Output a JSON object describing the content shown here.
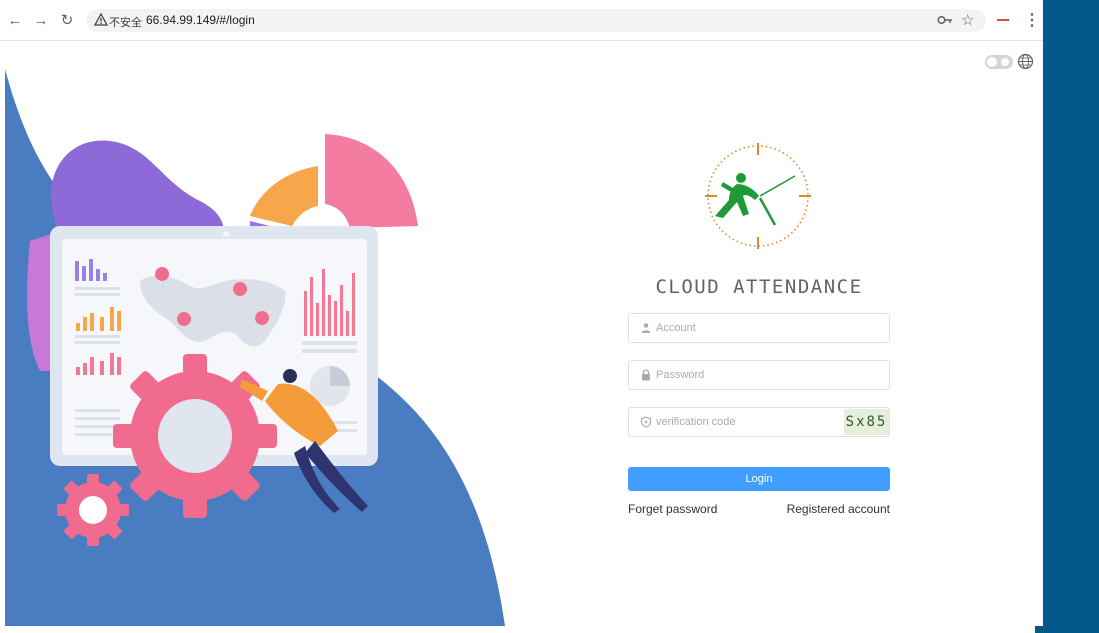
{
  "browser": {
    "security_label": "不安全",
    "url": "66.94.99.149/#/login"
  },
  "login": {
    "title": "CLOUD ATTENDANCE",
    "account_placeholder": "Account",
    "password_placeholder": "Password",
    "verification_placeholder": "verification code",
    "captcha_text": "Sx85",
    "login_button": "Login",
    "forget_password": "Forget password",
    "registered_account": "Registered account"
  },
  "colors": {
    "accent": "#409eff",
    "side_panel": "#03588c",
    "illustration_blue": "#4a7cc1",
    "logo_green": "#1e9a36",
    "logo_orange": "#e0892a"
  },
  "icons": [
    "back-arrow-icon",
    "forward-arrow-icon",
    "reload-icon",
    "warning-icon",
    "key-icon",
    "star-icon",
    "menu-icon",
    "theme-toggle-icon",
    "globe-icon",
    "user-icon",
    "lock-icon",
    "shield-icon"
  ]
}
